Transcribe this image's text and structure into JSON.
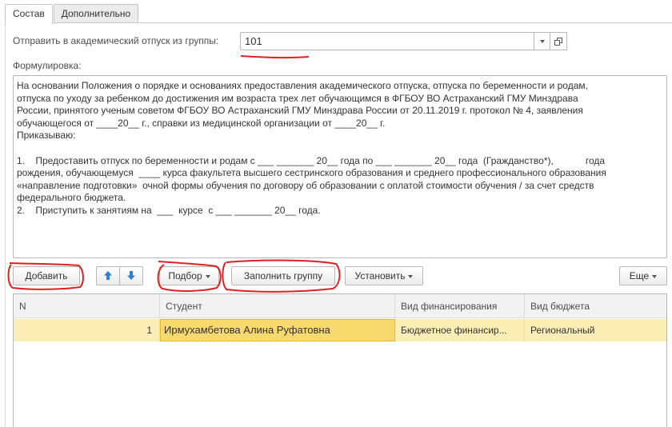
{
  "tabs": [
    {
      "label": "Состав"
    },
    {
      "label": "Дополнительно"
    }
  ],
  "group": {
    "label": "Отправить в академический отпуск из группы:",
    "value": "101"
  },
  "formulation": {
    "label": "Формулировка:",
    "text": "На основании Положения о порядке и основаниях предоставления академического отпуска, отпуска по беременности и родам,\nотпуска по уходу за ребенком до достижения им возраста трех лет обучающимся в ФГБОУ ВО Астраханский ГМУ Минздрава\nРоссии, принятого ученым советом ФГБОУ ВО Астраханский ГМУ Минздрава России от 20.11.2019 г. протокол № 4, заявления\nобучающегося от ____20__ г., справки из медицинской организации от ____20__ г.\nПриказываю:\n\n1.    Предоставить отпуск по беременности и родам с ___ _______ 20__ года по ___ _______ 20__ года  (Гражданство*),            года\nрождения, обучающемуся  ____ курса факультета высшего сестринского образования и среднего профессионального образования\n«направление подготовки»  очной формы обучения по договору об образовании с оплатой стоимости обучения / за счет средств\nфедерального бюджета.\n2.    Приступить к занятиям на  ___  курсе  с ___ _______ 20__ года."
  },
  "toolbar": {
    "add": "Добавить",
    "select": "Подбор",
    "fill_group": "Заполнить группу",
    "set": "Установить",
    "more": "Еще"
  },
  "table": {
    "columns": [
      "N",
      "Студент",
      "Вид финансирования",
      "Вид бюджета"
    ],
    "rows": [
      {
        "n": "1",
        "student": "Ирмухамбетова Алина Руфатовна",
        "financing": "Бюджетное финансир...",
        "budget": "Региональный"
      }
    ]
  },
  "colors": {
    "selected_row": "#fbeeb5",
    "selected_cell": "#f8d96e",
    "annotation_red": "#e02020",
    "arrow_blue": "#2e7fd6"
  }
}
